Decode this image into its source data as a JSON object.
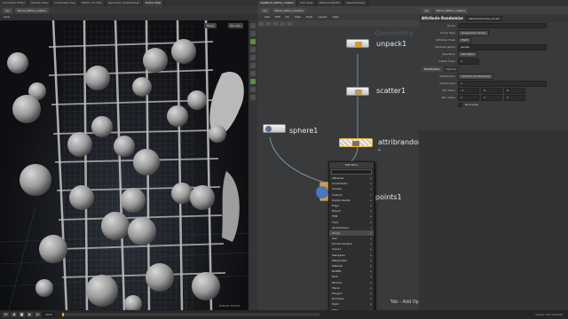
{
  "top_tabs_left": [
    "Animation Editor",
    "Render View",
    "Composite View",
    "Motion FX View",
    "Geometry Spreadsheet",
    "Scene View"
  ],
  "top_tabs_right": [
    "obj/Wood_define_clusters",
    "Tree View",
    "Material Palette",
    "Asset Browser"
  ],
  "left_panel": {
    "path_crumbs": [
      "obj",
      "Wood_define_clusters"
    ],
    "label": "View",
    "persp_label": "Persp",
    "cam_label": "No cam",
    "corner_label": "Collision Extent"
  },
  "network": {
    "path_crumbs": [
      "obj",
      "Wood_define_clusters"
    ],
    "menu": [
      "Add",
      "Edit",
      "Go",
      "View",
      "Tools",
      "Layout",
      "Help"
    ],
    "watermark": "Geometry",
    "nodes": {
      "unpack": "unpack1",
      "scatter": "scatter1",
      "sphere": "sphere1",
      "attribrandom": "attribrandom",
      "copytopoints": "opoints1"
    },
    "tab_hint": "Tab - Add Operator"
  },
  "tab_menu": {
    "title": "TAB Menu",
    "items": [
      "Attribute",
      "Constraints",
      "Crowds",
      "Custom",
      "Digital Assets",
      "Edge",
      "Export",
      "FEM",
      "Fluid",
      "Grid/Markers",
      "Group",
      "Hair",
      "Houdini Engine",
      "Import",
      "Managers",
      "Manipulate",
      "Material",
      "NURBS",
      "Pack",
      "Particle",
      "Planar",
      "Polygon",
      "Primitive",
      "Rigid",
      "RBD"
    ],
    "highlighted": "Group"
  },
  "params": {
    "path_crumbs": [
      "obj",
      "Wood_define_clusters"
    ],
    "node_type": "Attribute Randomize",
    "node_name": "attribrandomize_pscale",
    "rows": [
      {
        "label": "Group",
        "value": ""
      },
      {
        "label": "Group Type",
        "value": "Guess from Group"
      },
      {
        "label": "Attribute Class",
        "value": "Point"
      },
      {
        "label": "Attribute Name",
        "value": "pscale"
      },
      {
        "label": "Operation",
        "value": "Set Value"
      },
      {
        "label": "Global Scale",
        "value": "1"
      }
    ],
    "tabs": [
      "Distribution",
      "Options"
    ],
    "distribution": {
      "label": "Distribution",
      "value": "Uniform (Continuous)"
    },
    "dimensions": {
      "label": "Dimensions",
      "value": "1"
    },
    "min_value": {
      "label": "Min Value",
      "values": [
        "-1",
        "0",
        "0"
      ]
    },
    "max_value": {
      "label": "Max Value",
      "values": [
        "1",
        "1",
        "1"
      ]
    },
    "normalize": "Normalize"
  },
  "playbar": {
    "frame": "1074",
    "status": "9 keys, 0/0 channels"
  }
}
